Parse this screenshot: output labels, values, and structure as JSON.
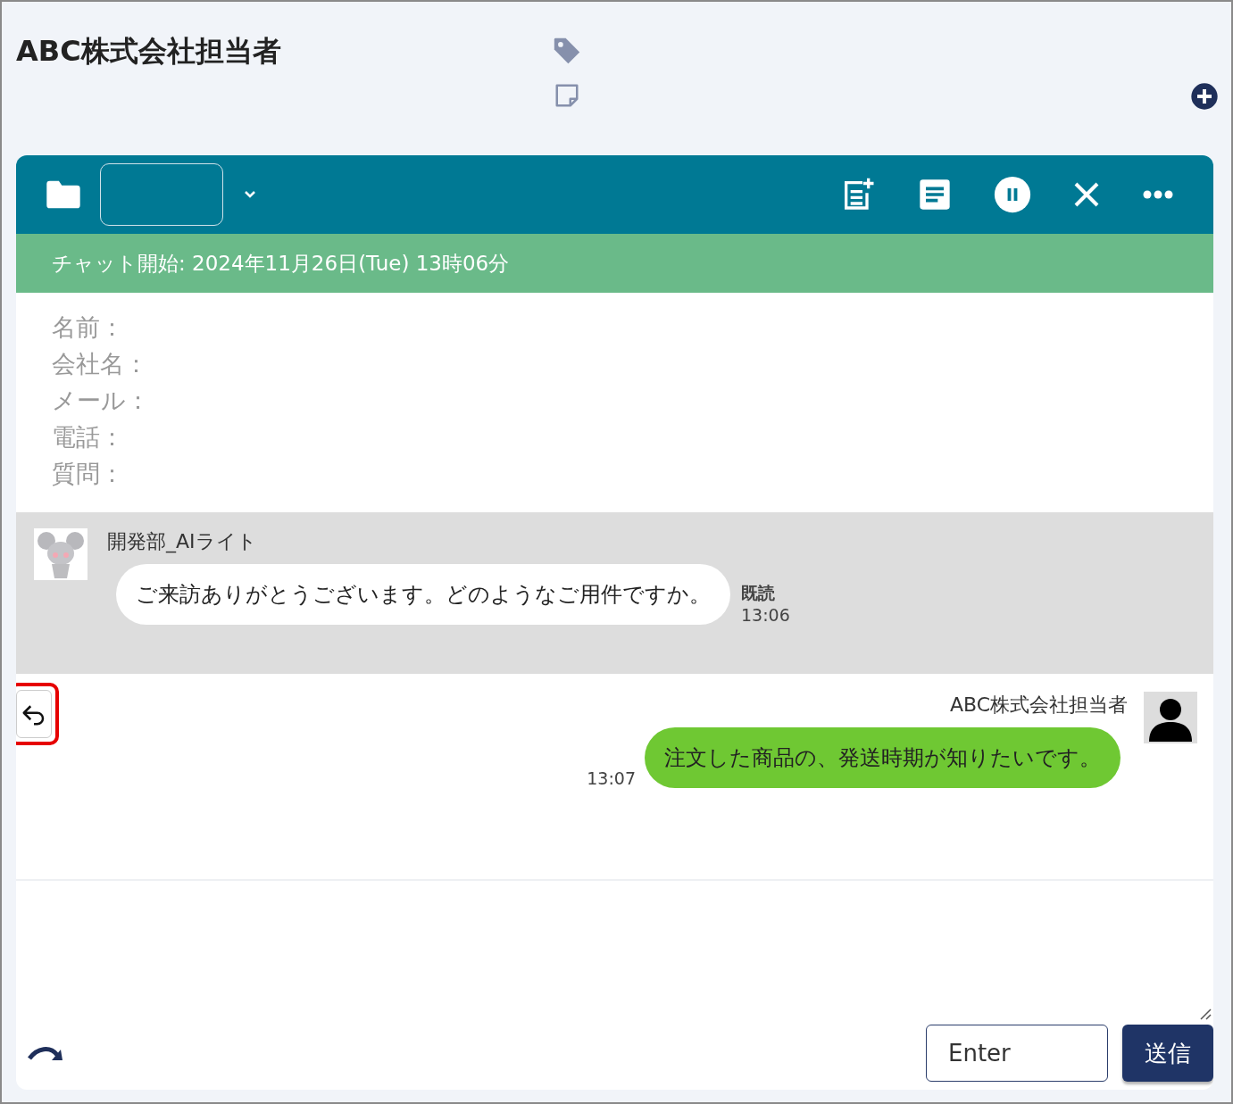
{
  "header": {
    "title": "ABC株式会社担当者"
  },
  "banner": {
    "text": "チャット開始: 2024年11月26日(Tue) 13時06分"
  },
  "form_fields": [
    "名前：",
    "会社名：",
    "メール：",
    "電話：",
    "質問："
  ],
  "messages": [
    {
      "kind": "incoming",
      "sender": "開発部_AIライト",
      "text": "ご来訪ありがとうございます。どのようなご用件ですか。",
      "read_status": "既読",
      "time": "13:06"
    },
    {
      "kind": "outgoing",
      "sender": "ABC株式会社担当者",
      "text": "注文した商品の、発送時期が知りたいです。",
      "time": "13:07"
    }
  ],
  "composer": {
    "buttons": [
      "Enter",
      "送信"
    ]
  }
}
